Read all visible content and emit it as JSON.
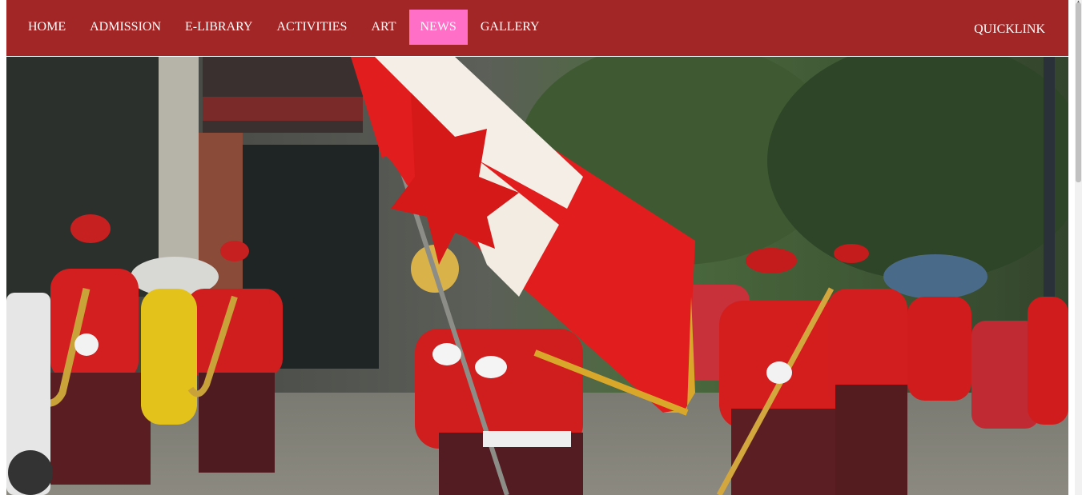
{
  "nav": {
    "items": [
      {
        "label": "HOME",
        "active": false
      },
      {
        "label": "ADMISSION",
        "active": false
      },
      {
        "label": "E-LIBRARY",
        "active": false
      },
      {
        "label": "ACTIVITIES",
        "active": false
      },
      {
        "label": "ART",
        "active": false
      },
      {
        "label": "NEWS",
        "active": true
      },
      {
        "label": "GALLERY",
        "active": false
      }
    ],
    "quicklink": "QUICKLINK"
  },
  "colors": {
    "navbar_bg": "#a32626",
    "active_item_bg": "#ff6ec7",
    "nav_text": "#ffffff"
  },
  "hero": {
    "icon": "parade-photo"
  }
}
